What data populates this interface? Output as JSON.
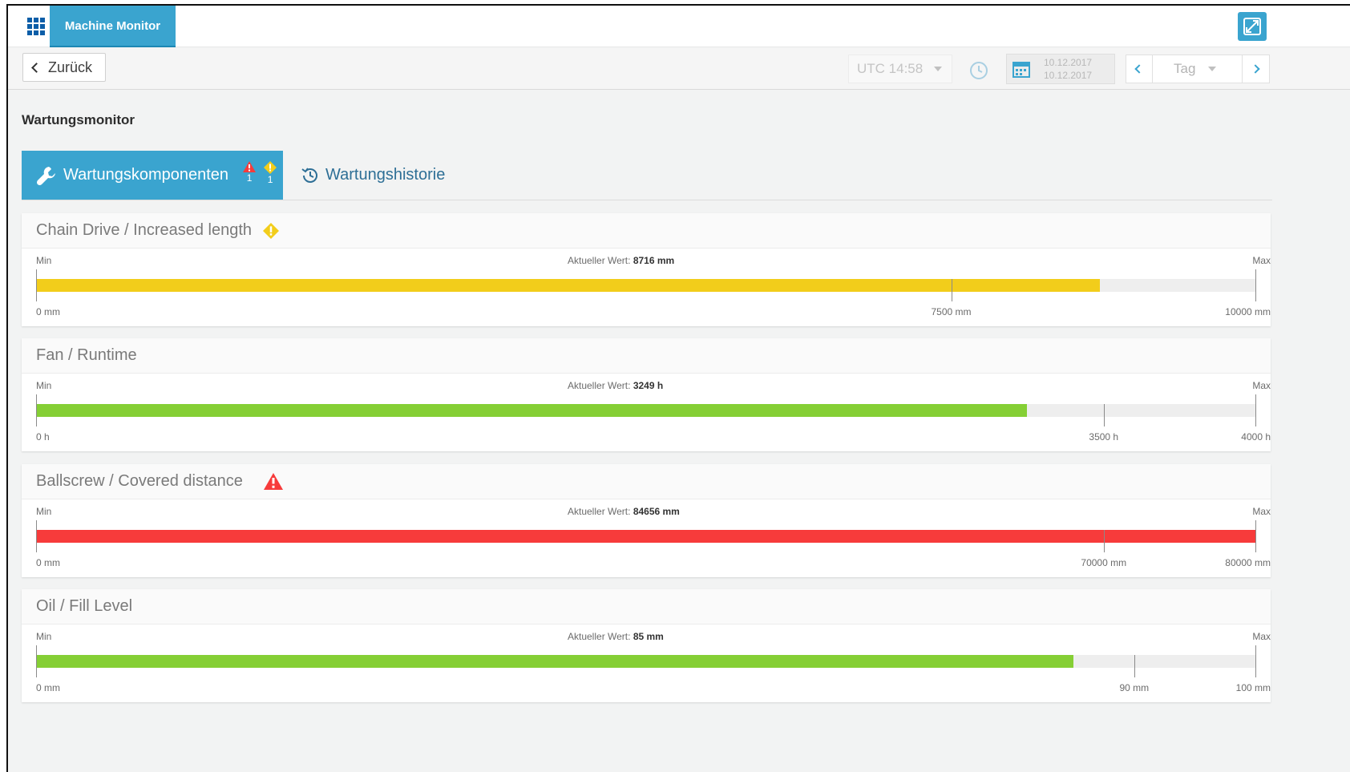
{
  "app": {
    "title": "Machine Monitor"
  },
  "toolbar": {
    "back_label": "Zurück",
    "time_label": "UTC 14:58",
    "date_from": "10.12.2017",
    "date_to": "10.12.2017",
    "period_label": "Tag"
  },
  "page": {
    "title": "Wartungsmonitor"
  },
  "tabs": {
    "components_label": "Wartungskomponenten",
    "alarm_count": "1",
    "warning_count": "1",
    "history_label": "Wartungshistorie"
  },
  "current_prefix": "Aktueller Wert:",
  "min_label": "Min",
  "max_label": "Max",
  "components": [
    {
      "title": "Chain Drive / Increased length",
      "status": "warning",
      "status_icon": "warning-diamond-icon",
      "current_value": "8716 mm",
      "value": 8716,
      "max": 10000,
      "threshold": 7500,
      "bar_color": "#f2cd1b",
      "min_tick": "0 mm",
      "threshold_tick": "7500 mm",
      "max_tick": "10000 mm"
    },
    {
      "title": "Fan / Runtime",
      "status": "ok",
      "status_icon": "",
      "current_value": "3249 h",
      "value": 3249,
      "max": 4000,
      "threshold": 3500,
      "bar_color": "#85cf35",
      "min_tick": "0 h",
      "threshold_tick": "3500 h",
      "max_tick": "4000 h"
    },
    {
      "title": "Ballscrew / Covered distance",
      "status": "alarm",
      "status_icon": "alarm-triangle-icon",
      "current_value": "84656 mm",
      "value": 84656,
      "max": 80000,
      "threshold": 70000,
      "bar_color": "#f73b3b",
      "min_tick": "0 mm",
      "threshold_tick": "70000 mm",
      "max_tick": "80000 mm"
    },
    {
      "title": "Oil / Fill Level",
      "status": "ok",
      "status_icon": "",
      "current_value": "85 mm",
      "value": 85,
      "max": 100,
      "threshold": 90,
      "bar_color": "#85cf35",
      "min_tick": "0 mm",
      "threshold_tick": "90 mm",
      "max_tick": "100 mm"
    }
  ]
}
